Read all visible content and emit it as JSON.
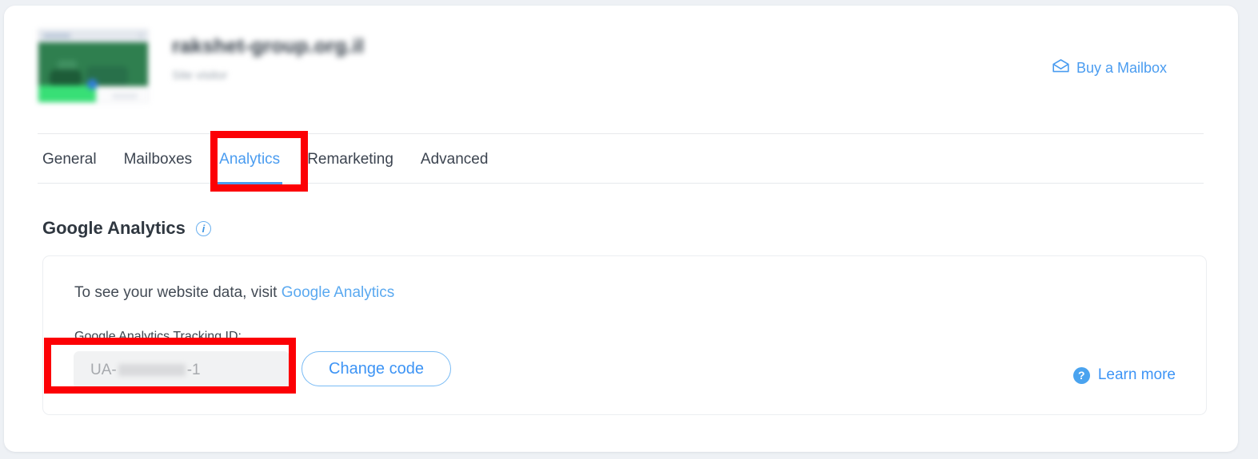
{
  "header": {
    "site_title": "rakshet-group.org.il",
    "site_subtitle": "Site visitor",
    "thumbnail_icon": "website-preview-thumbnail",
    "buy_mailbox": {
      "label": "Buy a Mailbox",
      "icon": "mail-envelope-icon"
    }
  },
  "tabs": {
    "items": [
      {
        "label": "General",
        "active": false
      },
      {
        "label": "Mailboxes",
        "active": false
      },
      {
        "label": "Analytics",
        "active": true
      },
      {
        "label": "Remarketing",
        "active": false
      },
      {
        "label": "Advanced",
        "active": false
      }
    ]
  },
  "section": {
    "title": "Google Analytics",
    "info_icon": "info-circle-icon"
  },
  "analytics_card": {
    "intro_prefix": "To see your website data, visit ",
    "intro_link": "Google Analytics",
    "tracking_id_label": "Google Analytics Tracking ID:",
    "tracking_id_prefix": "UA-",
    "tracking_id_suffix": "-1",
    "change_code_label": "Change code",
    "learn_more": {
      "label": "Learn more",
      "icon": "help-question-circle-icon"
    }
  },
  "annotations": [
    {
      "name": "analytics-tab-highlight",
      "color": "#fc0005"
    },
    {
      "name": "tracking-id-field-highlight",
      "color": "#fc0005"
    }
  ],
  "colors": {
    "page_background": "#eef1f5",
    "card_background": "#ffffff",
    "accent_blue": "#4a9cf0",
    "link_blue": "#3d94f5",
    "text_dark": "#303a45",
    "annotation_red": "#fc0005"
  }
}
